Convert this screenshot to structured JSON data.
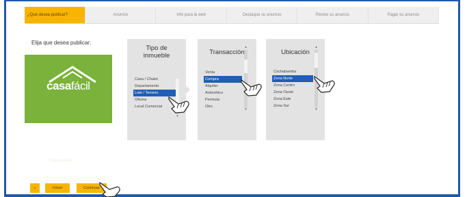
{
  "tabs": [
    {
      "label": "¿Qué desea publicar?",
      "active": true
    },
    {
      "label": "Anuncio",
      "active": false
    },
    {
      "label": "Info para la web",
      "active": false
    },
    {
      "label": "Destaque su anuncio",
      "active": false
    },
    {
      "label": "Revise su anuncio",
      "active": false
    },
    {
      "label": "Pagar su anuncio",
      "active": false
    }
  ],
  "prompt": "Elija que desea publicar:",
  "brand": {
    "logo_main": "casa",
    "logo_light": "fácil",
    "caption": "Subcasafácil"
  },
  "tipo": {
    "title": "Tipo de inmueble",
    "items": [
      "Casa / Chalet",
      "Departamento",
      "Lote / Terreno",
      "Oficina",
      "Local Comercial"
    ],
    "selected": "Lote / Terreno"
  },
  "transaccion": {
    "title": "Transacción",
    "items": [
      "Venta",
      "Compra",
      "Alquiler",
      "Anticrético",
      "Permuta",
      "Otro"
    ],
    "selected": "Compra"
  },
  "ubicacion": {
    "title": "Ubicación",
    "items": [
      "Cochabamba",
      "Zona Norte",
      "Zona Centro",
      "Zona Oeste",
      "Zona Este",
      "Zona Sur"
    ],
    "selected": "Zona Norte"
  },
  "buttons": {
    "left": "«",
    "back": "Volver",
    "continue": "Continuar"
  },
  "colors": {
    "accent": "#f7b500",
    "brand_green": "#7ab23c",
    "selection": "#1f5fb4",
    "frame": "#1e5aa8"
  }
}
